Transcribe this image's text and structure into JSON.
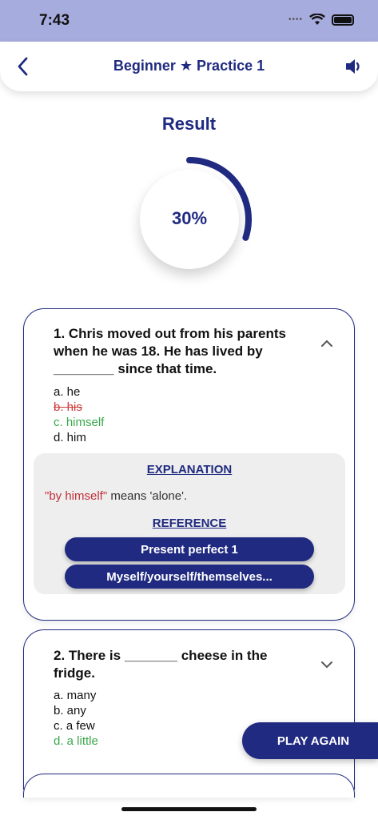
{
  "status": {
    "time": "7:43"
  },
  "header": {
    "title": "Beginner ★ Practice 1"
  },
  "result": {
    "title": "Result",
    "percent_label": "30%",
    "percent": 30
  },
  "questions": [
    {
      "text": "1. Chris moved out from his parents when he was 18. He has lived by ________ since that time.",
      "options": [
        {
          "label": "a. he",
          "state": "normal"
        },
        {
          "label": "b. his",
          "state": "wrong"
        },
        {
          "label": "c. himself",
          "state": "correct"
        },
        {
          "label": "d. him",
          "state": "normal"
        }
      ],
      "explanation": {
        "heading": "EXPLANATION",
        "highlight": "\"by himself\"",
        "text": " means 'alone'.",
        "reference_heading": "REFERENCE",
        "references": [
          "Present perfect 1",
          "Myself/yourself/themselves..."
        ]
      }
    },
    {
      "text": "2. There is _______ cheese in the fridge.",
      "options": [
        {
          "label": "a. many",
          "state": "normal"
        },
        {
          "label": "b. any",
          "state": "normal"
        },
        {
          "label": "c. a few",
          "state": "normal"
        },
        {
          "label": "d. a little",
          "state": "correct"
        }
      ]
    }
  ],
  "play_again_label": "PLAY AGAIN",
  "colors": {
    "primary": "#1f2a80",
    "wrong": "#d03a3a",
    "correct": "#3aa84a",
    "status_bar": "#a7acdf"
  }
}
